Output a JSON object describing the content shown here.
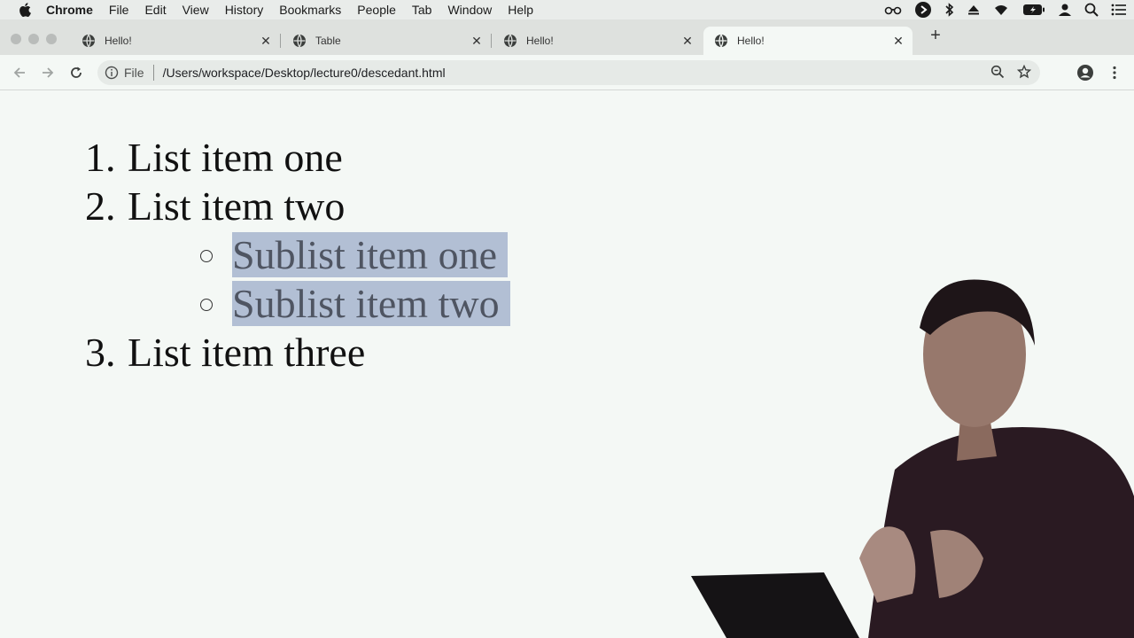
{
  "menubar": {
    "items": [
      "Chrome",
      "File",
      "Edit",
      "View",
      "History",
      "Bookmarks",
      "People",
      "Tab",
      "Window",
      "Help"
    ]
  },
  "tabs": [
    {
      "title": "Hello!",
      "active": false
    },
    {
      "title": "Table",
      "active": false
    },
    {
      "title": "Hello!",
      "active": false
    },
    {
      "title": "Hello!",
      "active": true
    }
  ],
  "toolbar": {
    "scheme": "File",
    "url": "/Users/workspace/Desktop/lecture0/descedant.html"
  },
  "page": {
    "ordered_list": [
      {
        "number": "1.",
        "text": "List item one"
      },
      {
        "number": "2.",
        "text": "List item two"
      },
      {
        "number": "3.",
        "text": "List item three"
      }
    ],
    "sublist": [
      {
        "text": "Sublist item one",
        "selected": true
      },
      {
        "text": "Sublist item two",
        "selected": true
      }
    ]
  },
  "colors": {
    "selection": "#b2bfd4",
    "page_background": "#f4f8f5",
    "tabstrip": "#dee1de"
  }
}
